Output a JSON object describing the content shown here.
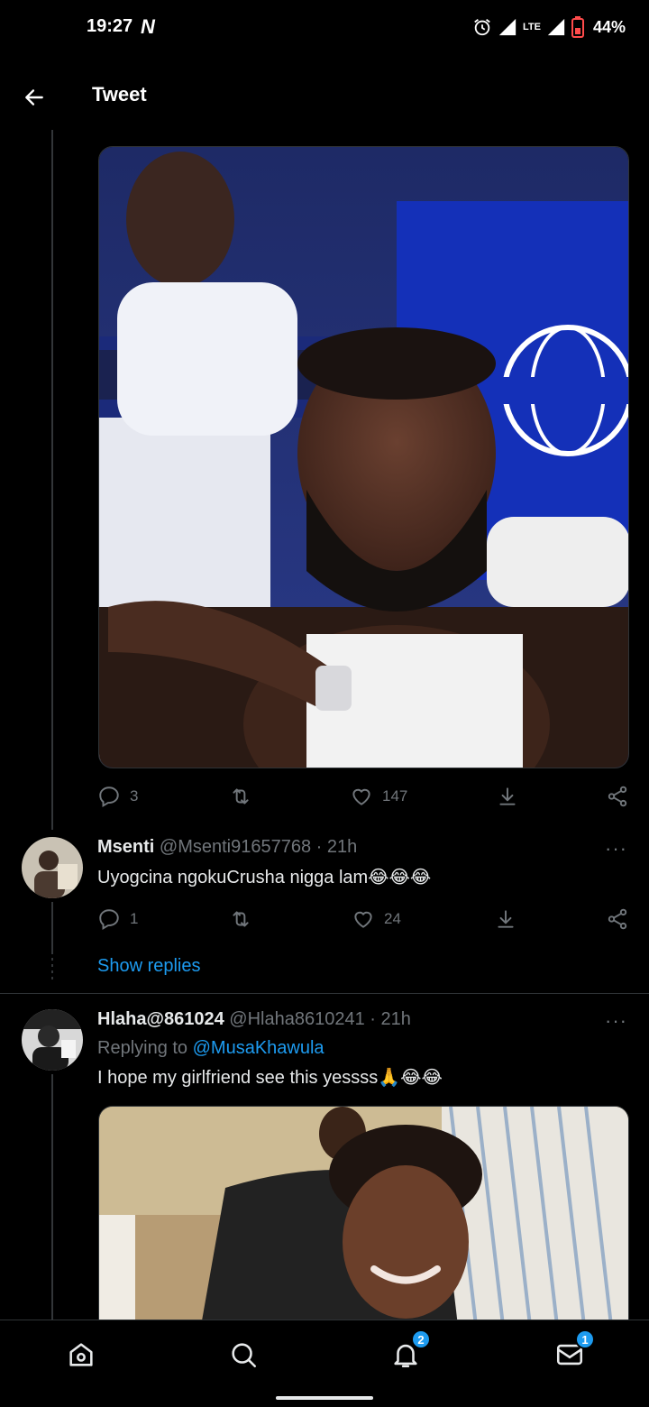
{
  "status_bar": {
    "time": "19:27",
    "notif_glyph": "N",
    "network": "LTE",
    "battery": "44%"
  },
  "header": {
    "title": "Tweet",
    "back_icon": "arrow-left-icon"
  },
  "main_tweet": {
    "media_icon": "photo",
    "stats": {
      "replies": "3",
      "retweets": "",
      "likes": "147"
    }
  },
  "replies": [
    {
      "name": "Msenti",
      "handle": "@Msenti91657768 · 21h",
      "text": "Uyogcina ngokuCrusha nigga lam😂😂😂",
      "stats": {
        "replies": "1",
        "retweets": "",
        "likes": "24"
      },
      "more": "···"
    },
    {
      "name": "Hlaha@861024",
      "handle": "@Hlaha8610241 · 21h",
      "replying_prefix": "Replying to",
      "replying_to": "@MusaKhawula",
      "text": "I hope my girlfriend see this yessss🙏😂😂",
      "more": "···"
    }
  ],
  "show_replies": "Show replies",
  "bottom_nav": {
    "items": [
      "home-icon",
      "search-icon",
      "bell-icon",
      "mail-icon"
    ],
    "notifications_badge": "2",
    "messages_badge": "1"
  },
  "colors": {
    "background": "#000000",
    "accent": "#1d9bf0",
    "muted": "#71767b"
  }
}
